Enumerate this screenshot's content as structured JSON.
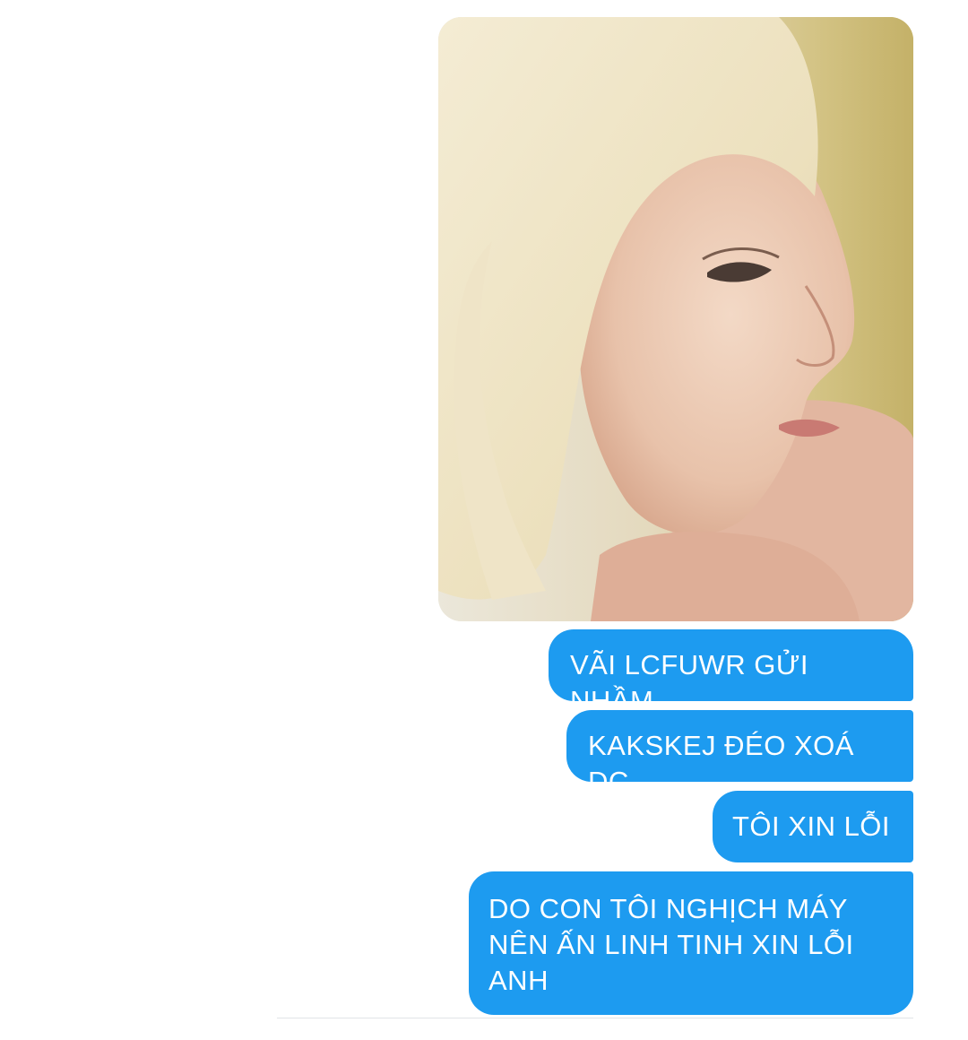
{
  "thread": {
    "photo": {
      "description_icon": "photo-portrait-icon"
    },
    "messages": [
      {
        "text": "VÃI LCFUWR GỬI NHẦM"
      },
      {
        "text": "KAKSKEJ ĐÉO XOÁ DC"
      },
      {
        "text": "TÔI XIN LỖI"
      },
      {
        "text": "DO CON TÔI NGHỊCH MÁY\nNÊN ẤN LINH TINH XIN LỖI\nANH"
      }
    ]
  },
  "colors": {
    "bubble": "#1d9bf0",
    "bubble_text": "#ffffff",
    "background": "#ffffff"
  }
}
